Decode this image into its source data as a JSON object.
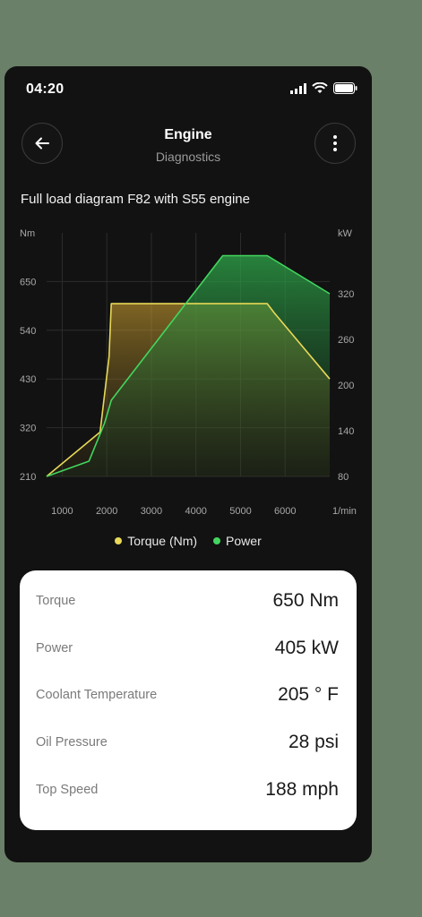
{
  "status": {
    "time": "04:20"
  },
  "header": {
    "title": "Engine",
    "subtitle": "Diagnostics"
  },
  "chart_title": "Full load diagram F82 with S55 engine",
  "colors": {
    "torque": "#e8d957",
    "power": "#43d65e",
    "background": "#121212"
  },
  "icons": {
    "back": "arrow-left-icon",
    "more": "more-vertical-icon"
  },
  "chart_data": {
    "type": "line",
    "title": "Full load diagram F82 with S55 engine",
    "x_unit": "1/min",
    "left_unit": "Nm",
    "right_unit": "kW",
    "x_ticks": [
      "1000",
      "2000",
      "3000",
      "4000",
      "5000",
      "6000"
    ],
    "left_ticks": [
      "650",
      "540",
      "430",
      "320",
      "210"
    ],
    "right_ticks": [
      "320",
      "260",
      "200",
      "140",
      "80"
    ],
    "xlim": [
      650,
      7000
    ],
    "ylim_left": [
      210,
      760
    ],
    "ylim_right": [
      80,
      400
    ],
    "grid": true,
    "series": [
      {
        "name": "Torque (Nm)",
        "axis": "left",
        "color": "#e8d957",
        "x": [
          650,
          1850,
          2050,
          2100,
          5600,
          5750,
          7000
        ],
        "y": [
          210,
          310,
          480,
          600,
          600,
          580,
          430
        ]
      },
      {
        "name": "Power",
        "axis": "right",
        "color": "#43d65e",
        "x": [
          650,
          1600,
          1950,
          2100,
          4600,
          5600,
          7000
        ],
        "y": [
          80,
          100,
          150,
          180,
          370,
          370,
          320
        ]
      }
    ]
  },
  "legend": [
    {
      "label": "Torque (Nm)",
      "color": "#e8d957"
    },
    {
      "label": "Power",
      "color": "#43d65e"
    }
  ],
  "metrics": [
    {
      "label": "Torque",
      "value": "650 Nm"
    },
    {
      "label": "Power",
      "value": "405 kW"
    },
    {
      "label": "Coolant Temperature",
      "value": "205 ° F"
    },
    {
      "label": "Oil Pressure",
      "value": "28 psi"
    },
    {
      "label": "Top Speed",
      "value": "188 mph"
    }
  ]
}
